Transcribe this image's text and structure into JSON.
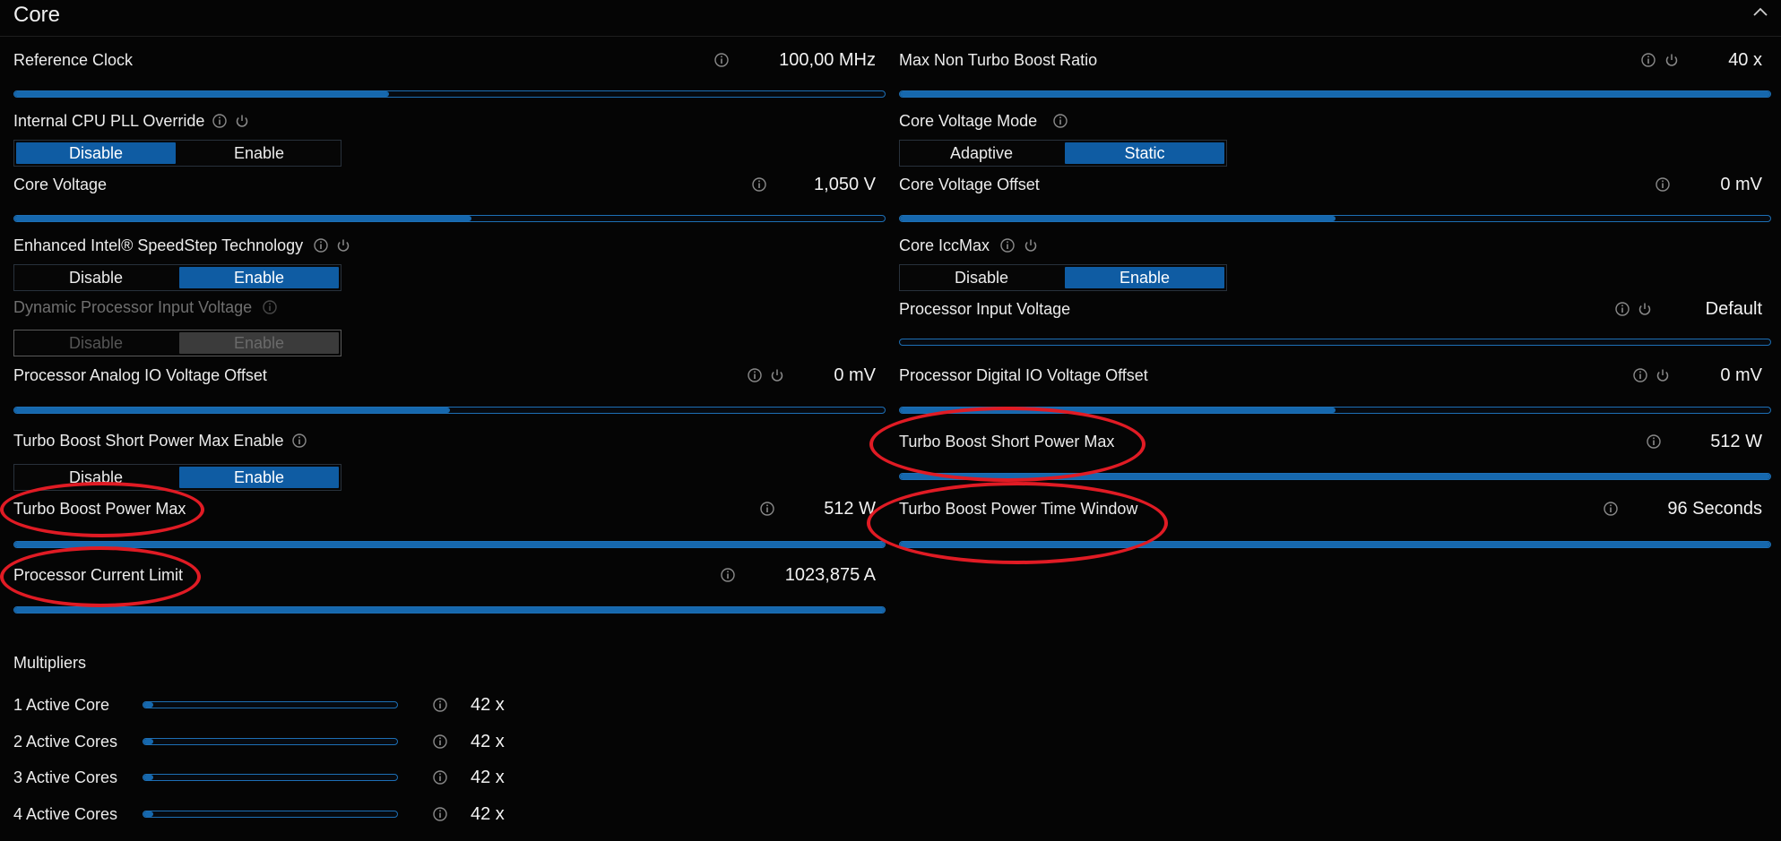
{
  "section": {
    "title": "Core"
  },
  "left": {
    "reference_clock": {
      "label": "Reference Clock",
      "value": "100,00 MHz",
      "fill": 0.43
    },
    "pll_override": {
      "label": "Internal CPU PLL Override",
      "options": [
        "Disable",
        "Enable"
      ],
      "selected": "Disable"
    },
    "core_voltage": {
      "label": "Core Voltage",
      "value": "1,050 V",
      "fill": 0.525
    },
    "speedstep": {
      "label": "Enhanced Intel® SpeedStep Technology",
      "options": [
        "Disable",
        "Enable"
      ],
      "selected": "Enable"
    },
    "dynamic_input_voltage": {
      "label": "Dynamic Processor Input Voltage",
      "options": [
        "Disable",
        "Enable"
      ],
      "selected": "Enable"
    },
    "analog_io_offset": {
      "label": "Processor Analog IO Voltage Offset",
      "value": "0 mV",
      "fill": 0.5
    },
    "short_power_max_enable": {
      "label": "Turbo Boost Short Power Max Enable",
      "options": [
        "Disable",
        "Enable"
      ],
      "selected": "Enable"
    },
    "power_max": {
      "label": "Turbo Boost Power Max",
      "value": "512 W",
      "fill": 1.0
    },
    "current_limit": {
      "label": "Processor Current Limit",
      "value": "1023,875 A",
      "fill": 1.0
    }
  },
  "right": {
    "max_non_turbo_ratio": {
      "label": "Max Non Turbo Boost Ratio",
      "value": "40 x",
      "fill": 1.0
    },
    "core_voltage_mode": {
      "label": "Core Voltage Mode",
      "options": [
        "Adaptive",
        "Static"
      ],
      "selected": "Static"
    },
    "core_voltage_offset": {
      "label": "Core Voltage Offset",
      "value": "0 mV",
      "fill": 0.5
    },
    "core_iccmax": {
      "label": "Core IccMax",
      "options": [
        "Disable",
        "Enable"
      ],
      "selected": "Enable"
    },
    "processor_input_voltage": {
      "label": "Processor Input Voltage",
      "value": "Default",
      "fill": 0.0
    },
    "digital_io_offset": {
      "label": "Processor Digital IO Voltage Offset",
      "value": "0 mV",
      "fill": 0.5
    },
    "short_power_max": {
      "label": "Turbo Boost Short Power Max",
      "value": "512 W",
      "fill": 1.0
    },
    "power_time_window": {
      "label": "Turbo Boost Power Time Window",
      "value": "96 Seconds",
      "fill": 1.0
    }
  },
  "multipliers": {
    "title": "Multipliers",
    "rows": [
      {
        "label": "1 Active Core",
        "value": "42 x",
        "fill": 0.04
      },
      {
        "label": "2 Active Cores",
        "value": "42 x",
        "fill": 0.04
      },
      {
        "label": "3 Active Cores",
        "value": "42 x",
        "fill": 0.04
      },
      {
        "label": "4 Active Cores",
        "value": "42 x",
        "fill": 0.04
      }
    ]
  },
  "annotations": {
    "color": "#e01b24"
  },
  "colors": {
    "accent": "#0f5ca3",
    "slider_border": "#1d6fb5",
    "background": "#050505"
  },
  "icons": {
    "info": "info-icon",
    "reset": "power-reset-icon",
    "collapse": "chevron-up-icon"
  }
}
